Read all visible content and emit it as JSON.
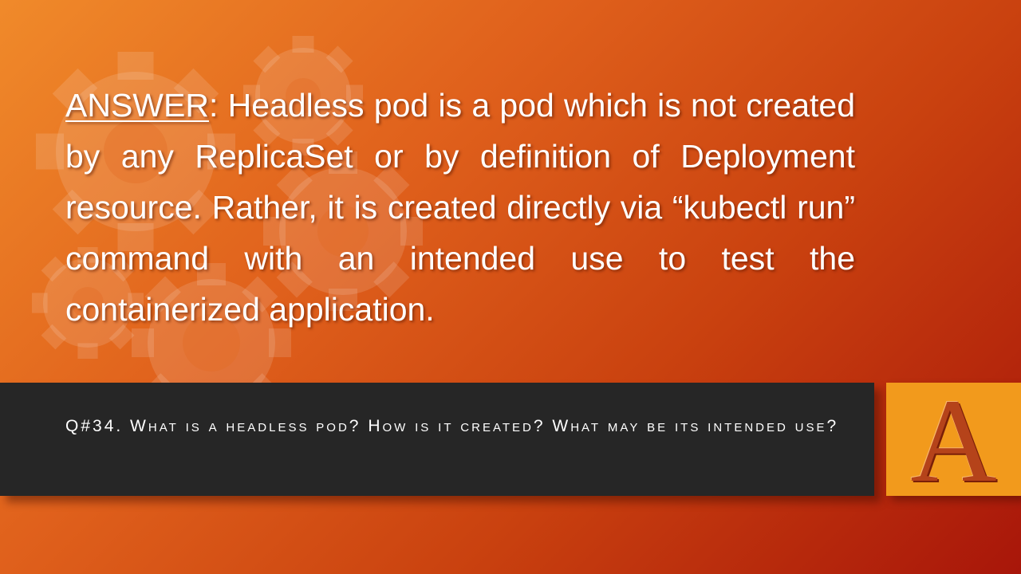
{
  "answer": {
    "label": "ANSWER",
    "colon": ":",
    "text": " Headless pod is a pod which is not created by any ReplicaSet or by definition of Deployment resource. Rather, it is created directly via “kubectl run” command with an intended use to test the containerized application."
  },
  "question": {
    "text": "Q#34. What is a headless pod? How is it created? What may be its intended use?"
  },
  "badge": {
    "letter": "A"
  },
  "colors": {
    "bar": "#262626",
    "badge": "#f29a1c",
    "badge_letter": "#b5431a",
    "gradient_start": "#f08a2a",
    "gradient_end": "#a8160a"
  },
  "icons": {
    "background": "gears-decoration-icon"
  }
}
